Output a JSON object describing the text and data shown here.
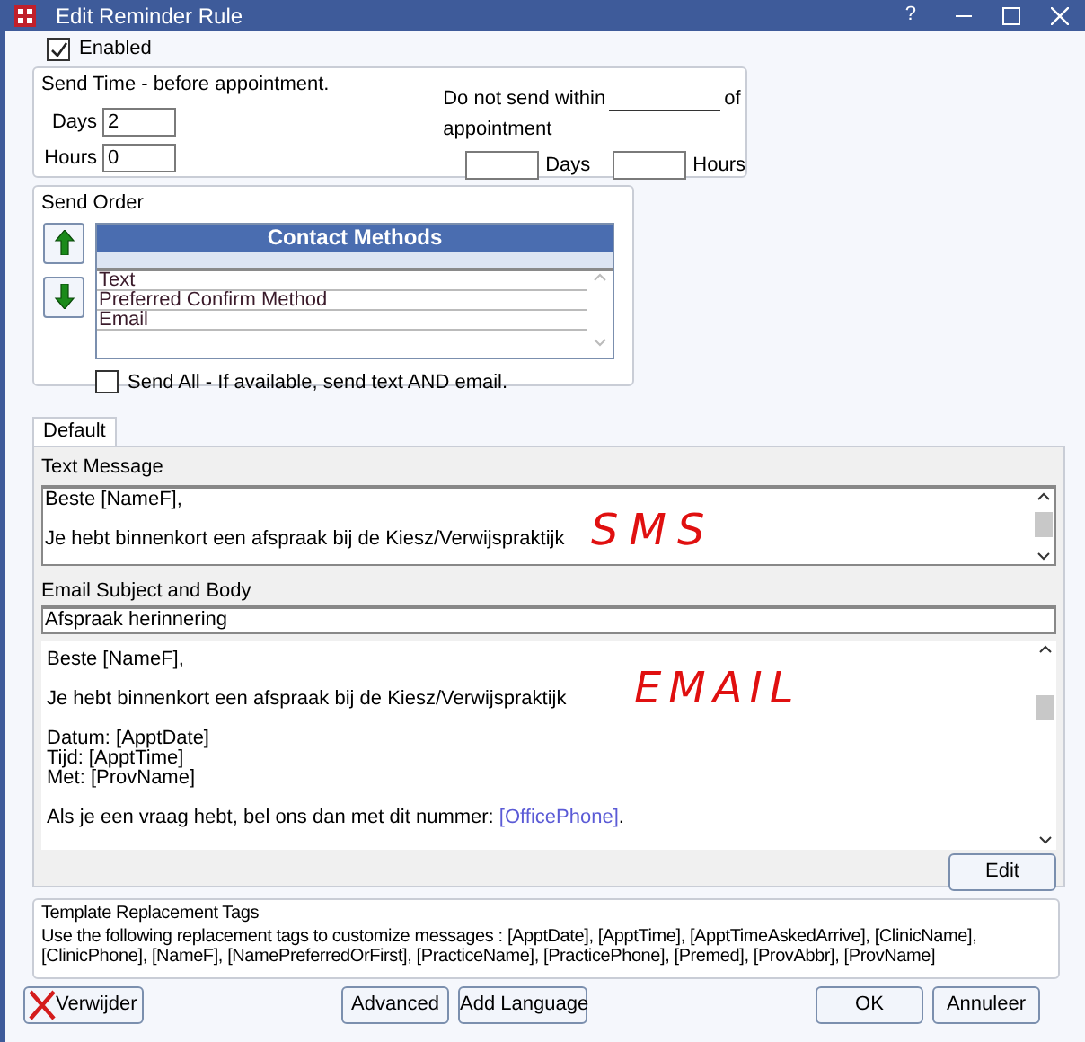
{
  "window": {
    "title": "Edit Reminder Rule",
    "help": "?"
  },
  "enabled": {
    "label": "Enabled",
    "checked": true
  },
  "send_time": {
    "title": "Send Time - before appointment.",
    "days": {
      "label": "Days",
      "value": "2"
    },
    "hours": {
      "label": "Hours",
      "value": "0"
    },
    "do_not_send": {
      "before": "Do not send within",
      "after": "of",
      "line2": "appointment",
      "days_label": "Days",
      "hours_label": "Hours"
    }
  },
  "send_order": {
    "title": "Send Order",
    "header": "Contact Methods",
    "methods": [
      {
        "label": "Text"
      },
      {
        "label": "Preferred Confirm Method"
      },
      {
        "label": "Email"
      }
    ],
    "send_all": {
      "label": "Send All - If available, send text AND email.",
      "checked": false
    }
  },
  "tabs": [
    {
      "label": "Default",
      "selected": true
    }
  ],
  "text_message": {
    "label": "Text Message",
    "paragraphs": [
      [
        {
          "text": "Beste [NameF],"
        }
      ],
      [
        {
          "text": "Je hebt binnenkort een afspraak bij de Kiesz/Verwijspraktijk"
        }
      ]
    ],
    "annotation": "SMS"
  },
  "email": {
    "subject_label": "Email Subject and Body",
    "subject": "Afspraak herinnering",
    "paragraphs": [
      [
        {
          "text": "Beste [NameF],"
        }
      ],
      [
        {
          "text": "Je hebt binnenkort een afspraak bij de Kiesz/Verwijspraktijk"
        }
      ],
      [
        {
          "text": "Datum: [ApptDate]"
        },
        {
          "text": "Tijd: [ApptTime]"
        },
        {
          "text": "Met: [ProvName]"
        }
      ],
      [
        {
          "text": "Als je een vraag hebt, bel ons dan met dit nummer: ",
          "tag": "[OfficePhone]",
          "after": "."
        }
      ]
    ],
    "annotation": "EMAIL",
    "edit_button": "Edit"
  },
  "template_tags": {
    "title": "Template Replacement Tags",
    "text": "Use the following replacement tags to customize messages : [ApptDate], [ApptTime], [ApptTimeAskedArrive], [ClinicName], [ClinicPhone], [NameF], [NamePreferredOrFirst], [PracticeName], [PracticePhone], [Premed], [ProvAbbr], [ProvName]"
  },
  "buttons": {
    "delete": "Verwijder",
    "advanced": "Advanced",
    "add_language": "Add Language",
    "ok": "OK",
    "cancel": "Annuleer"
  }
}
